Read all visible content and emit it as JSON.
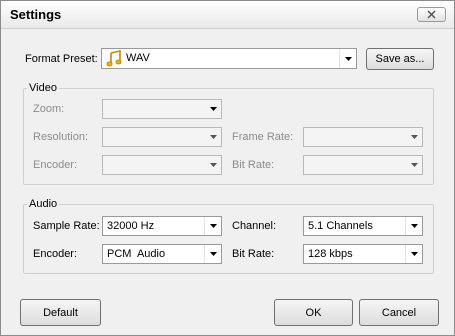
{
  "window": {
    "title": "Settings"
  },
  "format_preset": {
    "label": "Format Preset:",
    "value": "WAV",
    "icon": "music-note-icon",
    "save_as_label": "Save as..."
  },
  "video": {
    "group_label": "Video",
    "zoom_label": "Zoom:",
    "resolution_label": "Resolution:",
    "frame_rate_label": "Frame Rate:",
    "encoder_label": "Encoder:",
    "bit_rate_label": "Bit Rate:"
  },
  "audio": {
    "group_label": "Audio",
    "sample_rate_label": "Sample Rate:",
    "sample_rate_value": "32000 Hz",
    "channel_label": "Channel:",
    "channel_value": "5.1 Channels",
    "encoder_label": "Encoder:",
    "encoder_value": "PCM  Audio",
    "bit_rate_label": "Bit Rate:",
    "bit_rate_value": "128 kbps"
  },
  "buttons": {
    "default_label": "Default",
    "ok_label": "OK",
    "cancel_label": "Cancel"
  },
  "colors": {
    "dialog_bg": "#f0f0f0",
    "disabled_text": "#8c8c8c",
    "icon_yellow": "#f2b300"
  }
}
